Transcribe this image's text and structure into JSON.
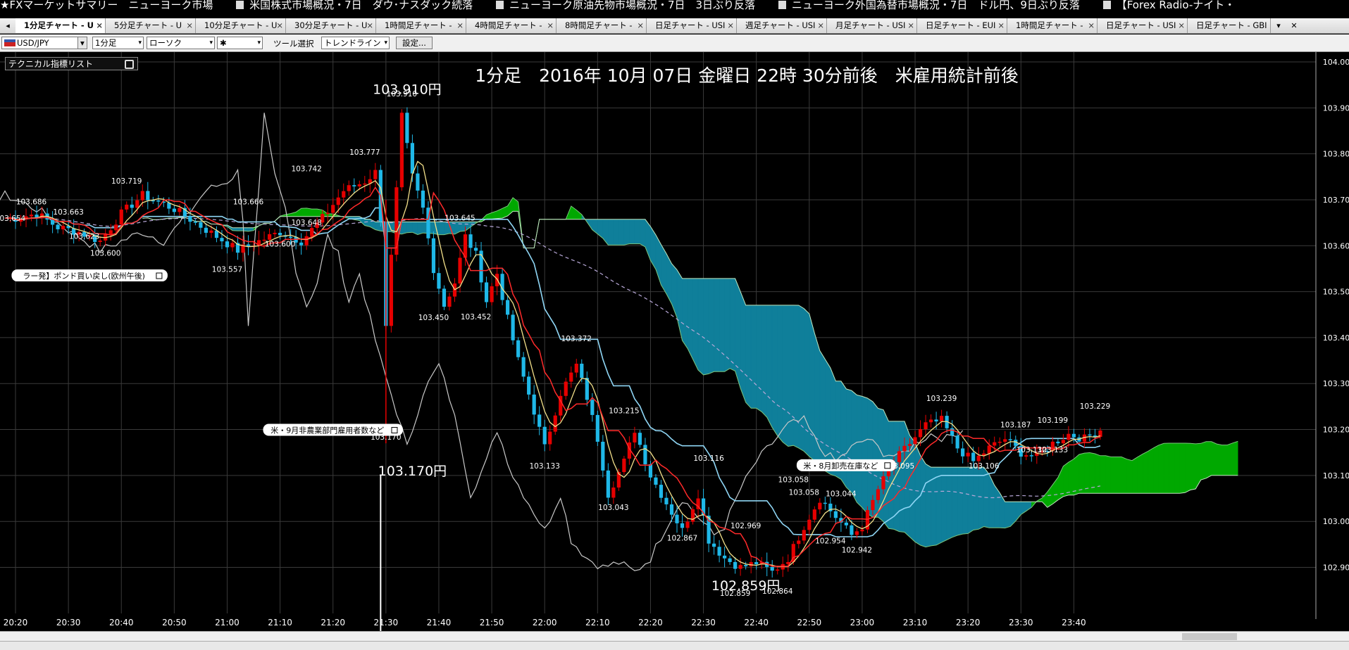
{
  "ticker": [
    "★FXマーケットサマリー　ニューヨーク市場",
    "米国株式市場概況・7日　ダウ･ナスダック続落",
    "ニューヨーク原油先物市場概況・7日　3日ぶり反落",
    "ニューヨーク外国為替市場概況・7日　ドル円、9日ぶり反落",
    "【Forex Radio-ナイト・"
  ],
  "tabs": [
    "1分足チャート - U",
    "5分足チャート - U",
    "10分足チャート - U",
    "30分足チャート - U",
    "1時間足チャート -",
    "4時間足チャート -",
    "8時間足チャート -",
    "日足チャート - USI",
    "週足チャート - USI",
    "月足チャート - USI",
    "日足チャート - EUI",
    "1時間足チャート -",
    "日足チャート - USI",
    "日足チャート - GBI"
  ],
  "toolbar": {
    "symbol": "USD/JPY",
    "timeframe": "1分足",
    "chart_style": "ローソク",
    "marker": "✱",
    "tool_label": "ツール選択",
    "tool_value": "トレンドライン",
    "settings_button": "設定..."
  },
  "indicator_panel": "テクニカル指標リスト",
  "colors": {
    "background": "#000000",
    "grid": "#3a3a3a",
    "candle_up": "#e60000",
    "candle_down": "#1fb8e8",
    "cloud_bearish": "#0f7f9a",
    "cloud_bullish": "#00a800",
    "chikou": "#c8c8c8",
    "tenkan": "#ff2a2a",
    "kijun": "#8fd6f5",
    "ma": "#f3e08a",
    "ma_long": "#b8a8d8"
  },
  "chart_data": {
    "type": "candlestick",
    "title": "1分足　2016年 10月 07日 金曜日 22時 30分前後　米雇用統計前後",
    "x_ticks": [
      "20:20",
      "20:30",
      "20:40",
      "20:50",
      "21:00",
      "21:10",
      "21:20",
      "21:30",
      "21:40",
      "21:50",
      "22:00",
      "22:10",
      "22:20",
      "22:30",
      "22:40",
      "22:50",
      "23:00",
      "23:10",
      "23:20",
      "23:30",
      "23:40"
    ],
    "y_ticks": [
      "104.00",
      "103.90",
      "103.80",
      "103.70",
      "103.60",
      "103.50",
      "103.40",
      "103.30",
      "103.20",
      "103.10",
      "103.00",
      "102.90"
    ],
    "ylim": [
      102.86,
      104.02
    ],
    "close_path": [
      [
        "20:20",
        103.66
      ],
      [
        "20:24",
        103.67
      ],
      [
        "20:28",
        103.64
      ],
      [
        "20:32",
        103.63
      ],
      [
        "20:36",
        103.61
      ],
      [
        "20:40",
        103.67
      ],
      [
        "20:44",
        103.71
      ],
      [
        "20:50",
        103.68
      ],
      [
        "20:58",
        103.62
      ],
      [
        "21:02",
        103.59
      ],
      [
        "21:06",
        103.61
      ],
      [
        "21:10",
        103.63
      ],
      [
        "21:14",
        103.61
      ],
      [
        "21:18",
        103.66
      ],
      [
        "21:22",
        103.72
      ],
      [
        "21:26",
        103.74
      ],
      [
        "21:28",
        103.76
      ],
      [
        "21:29",
        103.66
      ],
      [
        "21:30",
        103.43
      ],
      [
        "21:32",
        103.72
      ],
      [
        "21:33",
        103.88
      ],
      [
        "21:35",
        103.75
      ],
      [
        "21:37",
        103.68
      ],
      [
        "21:39",
        103.55
      ],
      [
        "21:41",
        103.47
      ],
      [
        "21:43",
        103.52
      ],
      [
        "21:45",
        103.62
      ],
      [
        "21:47",
        103.58
      ],
      [
        "21:49",
        103.48
      ],
      [
        "21:51",
        103.54
      ],
      [
        "21:53",
        103.44
      ],
      [
        "21:55",
        103.35
      ],
      [
        "21:58",
        103.24
      ],
      [
        "22:00",
        103.16
      ],
      [
        "22:03",
        103.28
      ],
      [
        "22:06",
        103.34
      ],
      [
        "22:08",
        103.27
      ],
      [
        "22:10",
        103.18
      ],
      [
        "22:12",
        103.06
      ],
      [
        "22:15",
        103.13
      ],
      [
        "22:17",
        103.2
      ],
      [
        "22:20",
        103.1
      ],
      [
        "22:23",
        103.04
      ],
      [
        "22:26",
        102.98
      ],
      [
        "22:29",
        103.06
      ],
      [
        "22:31",
        102.96
      ],
      [
        "22:34",
        102.92
      ],
      [
        "22:37",
        102.9
      ],
      [
        "22:40",
        102.91
      ],
      [
        "22:43",
        102.89
      ],
      [
        "22:46",
        102.92
      ],
      [
        "22:49",
        102.99
      ],
      [
        "22:52",
        103.05
      ],
      [
        "22:55",
        103.01
      ],
      [
        "22:58",
        102.97
      ],
      [
        "23:00",
        102.99
      ],
      [
        "23:03",
        103.07
      ],
      [
        "23:06",
        103.13
      ],
      [
        "23:09",
        103.17
      ],
      [
        "23:12",
        103.21
      ],
      [
        "23:15",
        103.22
      ],
      [
        "23:18",
        103.16
      ],
      [
        "23:21",
        103.13
      ],
      [
        "23:24",
        103.16
      ],
      [
        "23:27",
        103.18
      ],
      [
        "23:30",
        103.15
      ],
      [
        "23:33",
        103.14
      ],
      [
        "23:36",
        103.17
      ],
      [
        "23:39",
        103.19
      ],
      [
        "23:42",
        103.18
      ],
      [
        "23:45",
        103.2
      ]
    ],
    "highs_lows": [
      {
        "label": "103.686",
        "t": "20:23",
        "p": 103.69
      },
      {
        "label": "103.654",
        "t": "20:19",
        "p": 103.654
      },
      {
        "label": "103.663",
        "t": "20:30",
        "p": 103.668
      },
      {
        "label": "103.623",
        "t": "20:33",
        "p": 103.615
      },
      {
        "label": "103.600",
        "t": "20:37",
        "p": 103.578
      },
      {
        "label": "103.719",
        "t": "20:41",
        "p": 103.735
      },
      {
        "label": "103.557",
        "t": "21:00",
        "p": 103.543
      },
      {
        "label": "103.666",
        "t": "21:04",
        "p": 103.69
      },
      {
        "label": "103.600",
        "t": "21:10",
        "p": 103.598
      },
      {
        "label": "103.648",
        "t": "21:15",
        "p": 103.645
      },
      {
        "label": "103.742",
        "t": "21:15",
        "p": 103.762
      },
      {
        "label": "103.777",
        "t": "21:26",
        "p": 103.798
      },
      {
        "label": "103.910",
        "t": "21:33",
        "p": 103.925
      },
      {
        "label": "103.170",
        "t": "21:30",
        "p": 103.178
      },
      {
        "label": "103.645",
        "t": "21:44",
        "p": 103.655
      },
      {
        "label": "103.450",
        "t": "21:39",
        "p": 103.438
      },
      {
        "label": "103.452",
        "t": "21:47",
        "p": 103.44
      },
      {
        "label": "103.372",
        "t": "22:06",
        "p": 103.392
      },
      {
        "label": "103.215",
        "t": "22:15",
        "p": 103.235
      },
      {
        "label": "103.133",
        "t": "22:00",
        "p": 103.115
      },
      {
        "label": "103.116",
        "t": "22:31",
        "p": 103.132
      },
      {
        "label": "103.043",
        "t": "22:13",
        "p": 103.025
      },
      {
        "label": "102.867",
        "t": "22:26",
        "p": 102.958
      },
      {
        "label": "102.969",
        "t": "22:38",
        "p": 102.985
      },
      {
        "label": "103.058",
        "t": "22:47",
        "p": 103.085
      },
      {
        "label": "103.058",
        "t": "22:49",
        "p": 103.058
      },
      {
        "label": "103.044",
        "t": "22:56",
        "p": 103.055
      },
      {
        "label": "102.954",
        "t": "22:54",
        "p": 102.952
      },
      {
        "label": "102.942",
        "t": "22:59",
        "p": 102.932
      },
      {
        "label": "102.859",
        "t": "22:36",
        "p": 102.838
      },
      {
        "label": "102.864",
        "t": "22:44",
        "p": 102.843
      },
      {
        "label": "103.095",
        "t": "23:07",
        "p": 103.115
      },
      {
        "label": "103.239",
        "t": "23:15",
        "p": 103.262
      },
      {
        "label": "103.106",
        "t": "23:23",
        "p": 103.115
      },
      {
        "label": "103.187",
        "t": "23:29",
        "p": 103.205
      },
      {
        "label": "103.199",
        "t": "23:36",
        "p": 103.215
      },
      {
        "label": "103.229",
        "t": "23:44",
        "p": 103.245
      },
      {
        "label": "103.132",
        "t": "23:32",
        "p": 103.15
      },
      {
        "label": "103.133",
        "t": "23:36",
        "p": 103.15
      }
    ],
    "big_labels": [
      {
        "text": "103.910円",
        "t": "21:34",
        "p": 103.93
      },
      {
        "text": "103.170円",
        "t": "21:35",
        "p": 103.1
      },
      {
        "text": "102.859円",
        "t": "22:38",
        "p": 102.85
      }
    ],
    "news_labels": [
      {
        "text": "ラー発】ポンド買い戻し(欧州午後)",
        "t": "20:34",
        "p": 103.533
      },
      {
        "text": "米・9月非農業部門雇用者数など",
        "t": "21:20",
        "p": 103.197
      },
      {
        "text": "米・8月卸売在庫など",
        "t": "22:57",
        "p": 103.12
      }
    ]
  }
}
